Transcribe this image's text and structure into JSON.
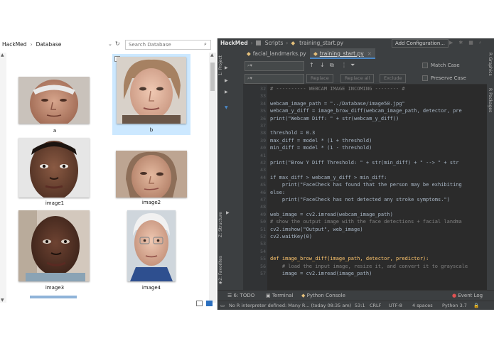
{
  "explorer": {
    "path": [
      "HackMed",
      "Database"
    ],
    "search_placeholder": "Search Database",
    "images": [
      {
        "name": "a"
      },
      {
        "name": "b",
        "selected": true
      },
      {
        "name": "image1"
      },
      {
        "name": "image2"
      },
      {
        "name": "image3"
      },
      {
        "name": "image4"
      }
    ]
  },
  "ide": {
    "breadcrumbs": [
      "HackMed",
      "Scripts",
      "training_start.py"
    ],
    "add_config": "Add Configuration...",
    "left_panels": [
      "1: Project",
      "Z: Structure",
      "2: Favorites"
    ],
    "right_panels": [
      "R Graphics",
      "R Packages"
    ],
    "tabs": [
      {
        "label": "facial_landmarks.py",
        "active": false
      },
      {
        "label": "training_start.py",
        "active": true
      }
    ],
    "find": {
      "replace": "Replace",
      "replace_all": "Replace all",
      "exclude": "Exclude",
      "match_case": "Match Case",
      "preserve_case": "Preserve Case"
    },
    "code": [
      {
        "n": "32",
        "t": "# ---------- WEBCAM IMAGE INCOMING -------- #",
        "k": "c"
      },
      {
        "n": "33",
        "t": ""
      },
      {
        "n": "34",
        "t": "webcam_image_path = \"../Database/image50.jpg\"",
        "k": "s"
      },
      {
        "n": "35",
        "t": "webcam_y_diff = image_brow_diff(webcam_image_path, detector, pre",
        "k": ""
      },
      {
        "n": "36",
        "t": "print(\"Webcam Diff: \" + str(webcam_y_diff))",
        "k": ""
      },
      {
        "n": "37",
        "t": ""
      },
      {
        "n": "38",
        "t": "threshold = 0.3",
        "k": ""
      },
      {
        "n": "39",
        "t": "max_diff = model * (1 + threshold)",
        "k": ""
      },
      {
        "n": "40",
        "t": "min_diff = model * (1 - threshold)",
        "k": ""
      },
      {
        "n": "41",
        "t": ""
      },
      {
        "n": "42",
        "t": "print(\"Brow Y Diff Threshold: \" + str(min_diff) + \" --> \" + str",
        "k": ""
      },
      {
        "n": "43",
        "t": ""
      },
      {
        "n": "44",
        "t": "if max_diff > webcam_y_diff > min_diff:",
        "k": ""
      },
      {
        "n": "45",
        "t": "    print(\"FaceCheck has found that the person may be exhibiting",
        "k": ""
      },
      {
        "n": "46",
        "t": "else:",
        "k": ""
      },
      {
        "n": "47",
        "t": "    print(\"FaceCheck has not detected any stroke symptoms.\")",
        "k": ""
      },
      {
        "n": "48",
        "t": ""
      },
      {
        "n": "49",
        "t": "web_image = cv2.imread(webcam_image_path)",
        "k": ""
      },
      {
        "n": "50",
        "t": "# show the output image with the face detections + facial landma",
        "k": "c"
      },
      {
        "n": "51",
        "t": "cv2.imshow(\"Output\", web_image)",
        "k": ""
      },
      {
        "n": "52",
        "t": "cv2.waitKey(0)",
        "k": ""
      },
      {
        "n": "53",
        "t": "",
        "caret": true
      },
      {
        "n": "54",
        "t": ""
      },
      {
        "n": "55",
        "t": "def image_brow_diff(image_path, detector, predictor):",
        "k": "def"
      },
      {
        "n": "56",
        "t": "    # load the input image, resize it, and convert it to grayscale",
        "k": "c"
      },
      {
        "n": "57",
        "t": "    image = cv2.imread(image_path)",
        "k": ""
      }
    ],
    "bottom_tools": [
      "6: TODO",
      "Terminal",
      "Python Console",
      "Event Log"
    ],
    "status": {
      "message": "No R interpreter defined: Many R... (today 08:35 am)",
      "position": "53:1",
      "line_sep": "CRLF",
      "encoding": "UTF-8",
      "indent": "4 spaces",
      "interpreter": "Python 3.7"
    }
  }
}
